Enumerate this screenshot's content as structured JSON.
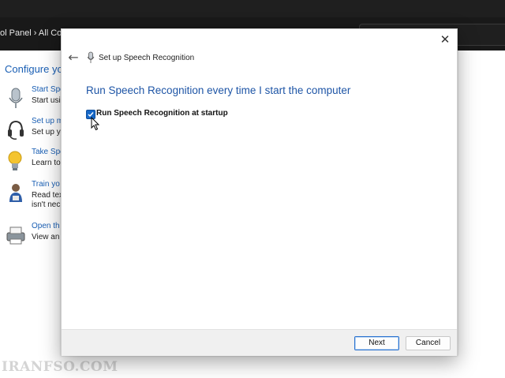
{
  "background_window": {
    "breadcrumb": "ol Panel  ›  All Co",
    "heading": "Configure yo",
    "items": [
      {
        "icon": "microphone-icon",
        "link": "Start Spe",
        "desc": "Start usi"
      },
      {
        "icon": "headset-icon",
        "link": "Set up m",
        "desc": "Set up y"
      },
      {
        "icon": "lightbulb-icon",
        "link": "Take Spe",
        "desc": "Learn to"
      },
      {
        "icon": "person-icon",
        "link": "Train yo",
        "desc": "Read tex\nisn't nec"
      },
      {
        "icon": "printer-icon",
        "link": "Open th",
        "desc": "View an"
      }
    ]
  },
  "dialog": {
    "title": "Set up Speech Recognition",
    "heading": "Run Speech Recognition every time I start the computer",
    "checkbox": {
      "label": "Run Speech Recognition at startup",
      "checked": true
    },
    "close_icon": "close-icon",
    "back_icon": "back-arrow-icon",
    "buttons": {
      "next": "Next",
      "cancel": "Cancel"
    }
  },
  "watermark": "IRANFSO.COM",
  "colors": {
    "accent": "#1668c8",
    "link": "#1a5fb4",
    "heading": "#1e55a6"
  }
}
